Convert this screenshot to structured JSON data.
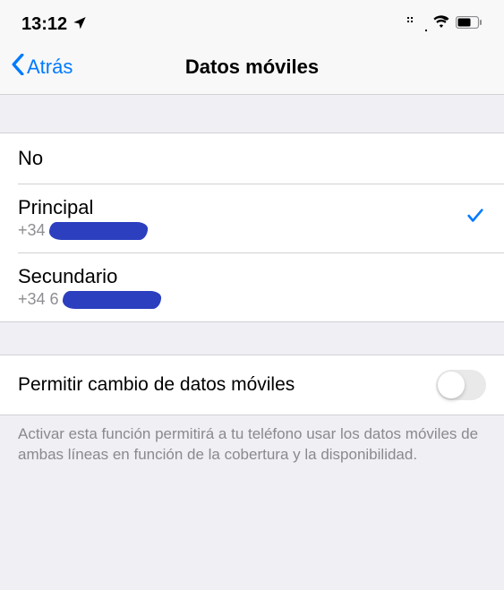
{
  "statusBar": {
    "time": "13:12"
  },
  "nav": {
    "backLabel": "Atrás",
    "title": "Datos móviles"
  },
  "options": {
    "off": "No",
    "primary": {
      "label": "Principal",
      "prefix": "+34"
    },
    "secondary": {
      "label": "Secundario",
      "prefix": "+34 6"
    }
  },
  "toggle": {
    "label": "Permitir cambio de datos móviles"
  },
  "footer": "Activar esta función permitirá a tu teléfono usar los datos móviles de ambas líneas en función de la cobertura y la disponibilidad."
}
